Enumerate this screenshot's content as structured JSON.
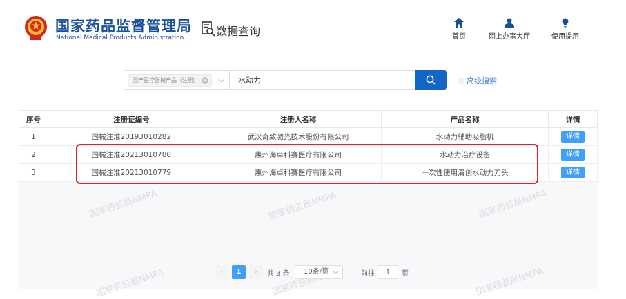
{
  "header": {
    "brand_cn": "国家药品监督管理局",
    "brand_en": "National Medical Products Administration",
    "section_title": "数据查询",
    "nav": [
      {
        "label": "首页",
        "icon": "home-icon"
      },
      {
        "label": "网上办事大厅",
        "icon": "user-icon"
      },
      {
        "label": "使用提示",
        "icon": "lightbulb-icon"
      }
    ]
  },
  "search": {
    "category_tag": "国产医疗器械产品（注册）",
    "keyword": "水动力",
    "advanced_label": "高级搜索"
  },
  "table": {
    "columns": [
      "序号",
      "注册证编号",
      "注册人名称",
      "产品名称",
      "详情"
    ],
    "rows": [
      {
        "index": "1",
        "reg_no": "国械注准20193010282",
        "registrant": "武汉奇致激光技术股份有限公司",
        "product": "水动力辅助吸脂机",
        "detail": "详情"
      },
      {
        "index": "2",
        "reg_no": "国械注准20213010780",
        "registrant": "惠州海卓科赛医疗有限公司",
        "product": "水动力治疗设备",
        "detail": "详情"
      },
      {
        "index": "3",
        "reg_no": "国械注准20213010779",
        "registrant": "惠州海卓科赛医疗有限公司",
        "product": "一次性使用清创水动力刀头",
        "detail": "详情"
      }
    ]
  },
  "watermark_text": "国家药监局NMPA",
  "pagination": {
    "current_page": "1",
    "total": "共 3 条",
    "page_size": "10条/页",
    "goto_prefix": "前往",
    "goto_value": "1",
    "goto_suffix": "页"
  },
  "colors": {
    "brand_blue": "#1a4f9c",
    "search_button": "#1266c6",
    "detail_button": "#409eff",
    "highlight_red": "#e0222a"
  }
}
